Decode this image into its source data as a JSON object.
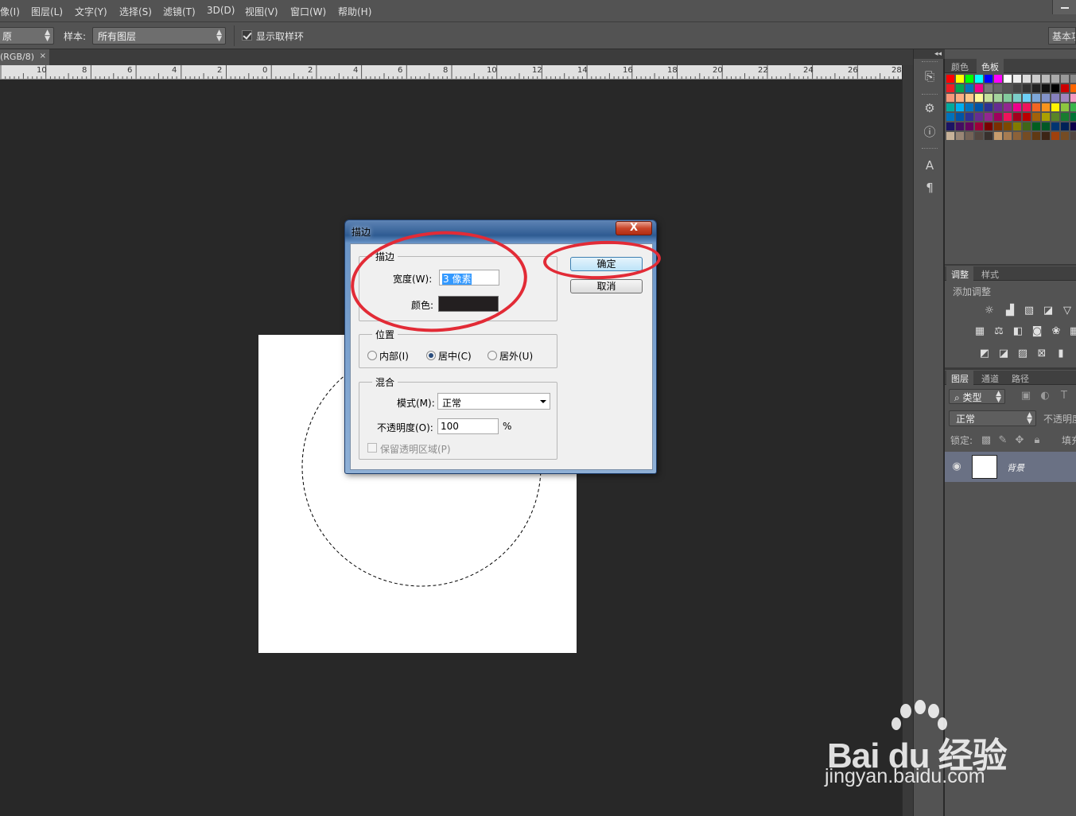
{
  "menubar": {
    "items": [
      "像(I)",
      "图层(L)",
      "文字(Y)",
      "选择(S)",
      "滤镜(T)",
      "3D(D)",
      "视图(V)",
      "窗口(W)",
      "帮助(H)"
    ]
  },
  "options_bar": {
    "first_select": "原",
    "sample_label": "样本:",
    "sample_value": "所有图层",
    "show_ring_label": "显示取样环",
    "workspace": "基本功"
  },
  "document_tab": {
    "label": "(RGB/8)",
    "close": "×"
  },
  "ruler": {
    "labels": [
      "10",
      "8",
      "6",
      "4",
      "2",
      "0",
      "2",
      "4",
      "6",
      "8",
      "10",
      "12",
      "14",
      "16",
      "18",
      "20",
      "22",
      "24",
      "26",
      "28"
    ]
  },
  "dock": {
    "collapse": "◂◂",
    "icons": [
      "history-icon",
      "properties-icon",
      "info-icon",
      "character-icon",
      "paragraph-icon"
    ]
  },
  "color_panel": {
    "tabs": [
      "颜色",
      "色板"
    ],
    "active_tab": "色板"
  },
  "adjustments_panel": {
    "tabs": [
      "调整",
      "样式"
    ],
    "title": "添加调整"
  },
  "layers_panel": {
    "tabs": [
      "图层",
      "通道",
      "路径"
    ],
    "filter_label": "类型",
    "blend_mode": "正常",
    "opacity_label": "不透明度",
    "lock_label": "锁定:",
    "fill_label": "填充",
    "layer_name": "背景"
  },
  "stroke_dialog": {
    "title": "描边",
    "close": "X",
    "stroke_group": "描边",
    "width_label": "宽度(W):",
    "width_value": "3 像素",
    "color_label": "颜色:",
    "stroke_color": "#231f20",
    "position_group": "位置",
    "position_options": [
      "内部(I)",
      "居中(C)",
      "居外(U)"
    ],
    "position_selected": "居中(C)",
    "blend_group": "混合",
    "mode_label": "模式(M):",
    "mode_value": "正常",
    "opacity_label": "不透明度(O):",
    "opacity_value": "100",
    "opacity_unit": "%",
    "preserve_label": "保留透明区域(P)",
    "ok": "确定",
    "cancel": "取消"
  },
  "annotation_color": "#e22b36",
  "watermark": {
    "main": "Bai du 经验",
    "sub": "jingyan.baidu.com"
  }
}
